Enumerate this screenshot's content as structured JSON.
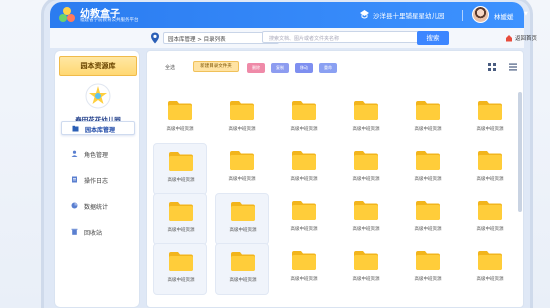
{
  "header": {
    "brand_name": "幼教盒子",
    "brand_sub": "福建省学前教育公共服务平台",
    "school_name": "沙洋县十里铺星星幼儿园",
    "user_name": "林媛媛",
    "accent": "#2b7cf0"
  },
  "toolbar": {
    "breadcrumb": "园本库管理 > 目录列表",
    "search_placeholder": "搜索文档、图片或者文件夹名称",
    "search_label": "搜索",
    "back_label": "返回首页"
  },
  "sidebar": {
    "title": "园本资源库",
    "kindergarten": "春田花花幼儿园",
    "items": [
      {
        "label": "园本库管理",
        "icon": "folder-manage-icon",
        "active": true
      },
      {
        "label": "角色管理",
        "icon": "user-icon",
        "active": false
      },
      {
        "label": "操作日志",
        "icon": "log-icon",
        "active": false
      },
      {
        "label": "数据统计",
        "icon": "chart-icon",
        "active": false
      },
      {
        "label": "回收站",
        "icon": "trash-icon",
        "active": false
      }
    ]
  },
  "actions": {
    "select_all": "全选",
    "new_folder": "新建目录文件夹",
    "btn_delete": "删除",
    "btn_copy": "复制",
    "btn_move": "移动",
    "btn_rename": "重命",
    "delete_color": "#ef8aa8",
    "copy_color": "#8d9cf0",
    "move_color": "#7e8ff0",
    "rename_color": "#8aa0f2"
  },
  "folders": {
    "label": "高级中班资源",
    "color": "#ffcd3a"
  }
}
